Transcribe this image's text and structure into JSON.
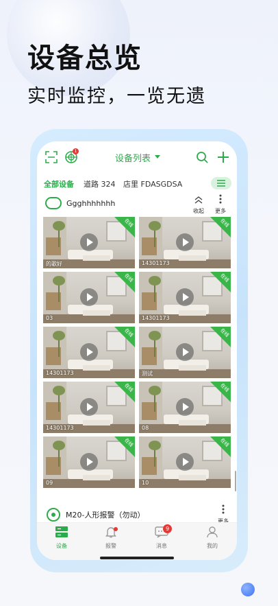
{
  "promo": {
    "headline": "设备总览",
    "subline": "实时监控，一览无遗"
  },
  "topbar": {
    "title": "设备列表",
    "radar_badge": "1"
  },
  "tabs": [
    {
      "label": "全部设备",
      "active": true
    },
    {
      "label": "道路 324",
      "active": false
    },
    {
      "label": "店里 FDASGDSA",
      "active": false
    }
  ],
  "group1": {
    "name": "Ggghhhhhhh",
    "collapse_label": "收起",
    "more_label": "更多"
  },
  "tiles": [
    {
      "label": "的歌好",
      "status": "在线"
    },
    {
      "label": "14301173",
      "status": "在线"
    },
    {
      "label": "03",
      "status": "在线"
    },
    {
      "label": "14301173",
      "status": "在线"
    },
    {
      "label": "14301173",
      "status": "在线"
    },
    {
      "label": "测试",
      "status": "在线"
    },
    {
      "label": "14301173",
      "status": "在线"
    },
    {
      "label": "08",
      "status": "在线"
    },
    {
      "label": "09",
      "status": "在线"
    },
    {
      "label": "10",
      "status": "在线"
    }
  ],
  "group2": {
    "name": "M20-人形报警（勿动）",
    "more_label": "更多"
  },
  "bottom_nav": [
    {
      "label": "设备",
      "active": true
    },
    {
      "label": "报警",
      "active": false
    },
    {
      "label": "消息",
      "active": false,
      "badge": "9"
    },
    {
      "label": "我的",
      "active": false
    }
  ],
  "colors": {
    "accent": "#2cab4b",
    "online_ribbon": "#39b54a",
    "badge": "#e53935"
  }
}
